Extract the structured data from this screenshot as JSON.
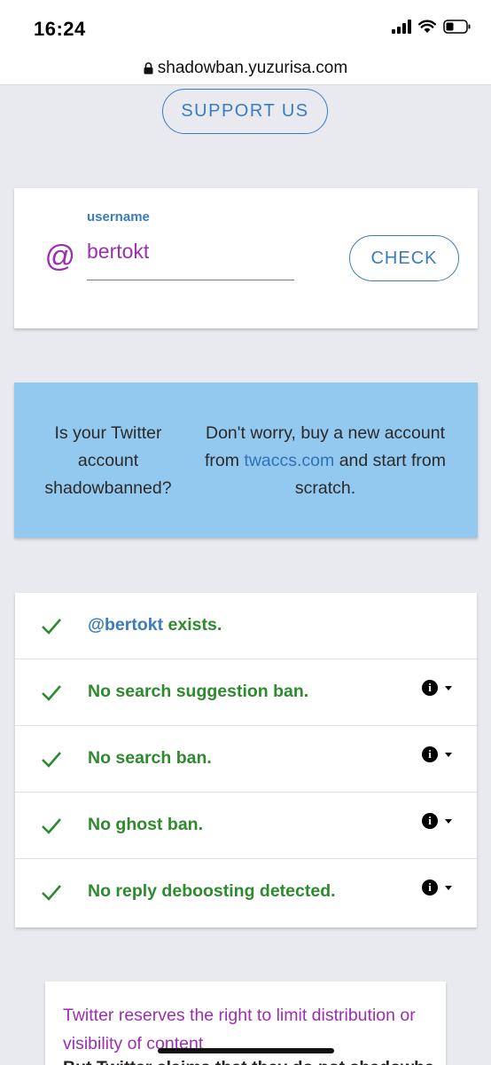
{
  "status_bar": {
    "time": "16:24"
  },
  "browser": {
    "url": "shadowban.yuzurisa.com"
  },
  "support_button": {
    "label": "SUPPORT US"
  },
  "search": {
    "field_label": "username",
    "at_symbol": "@",
    "value": "bertokt",
    "check_label": "CHECK"
  },
  "ad": {
    "left_text": "Is your Twitter account shadowbanned?",
    "right_prefix": "Don't worry, buy a new account from ",
    "right_link": "twaccs.com",
    "right_suffix": " and start from scratch."
  },
  "results": [
    {
      "handle": "@bertokt",
      "text": " exists.",
      "has_info": false
    },
    {
      "text": "No search suggestion ban.",
      "has_info": true
    },
    {
      "text": "No search ban.",
      "has_info": true
    },
    {
      "text": "No ghost ban.",
      "has_info": true
    },
    {
      "text": "No reply deboosting detected.",
      "has_info": true
    }
  ],
  "notice": {
    "text": "Twitter reserves the right to limit distribution or visibility of content",
    "subtext": "But Twitter claims that they do not shadowban"
  },
  "colors": {
    "accent_blue": "#3b7bbf",
    "purple": "#9c2fb0",
    "success_green": "#2e8a2e",
    "ad_background": "#93c9ee",
    "page_background": "#e8eaef"
  }
}
